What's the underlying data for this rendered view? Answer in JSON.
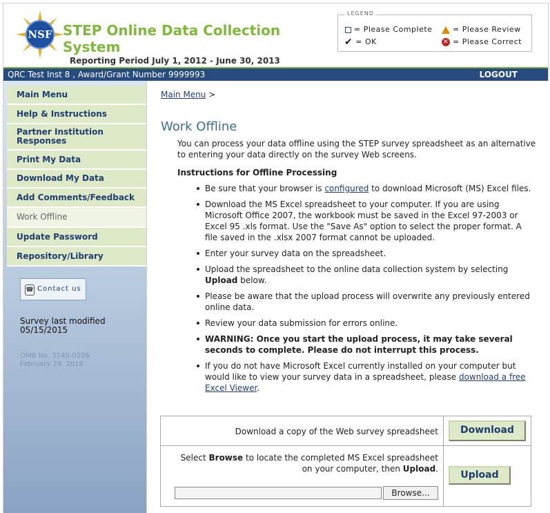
{
  "header": {
    "title_line1": "STEP Online Data Collection",
    "title_line2": "System",
    "reporting_period": "Reporting Period July 1, 2012 - June 30, 2013",
    "logo_text": "NSF"
  },
  "legend": {
    "title": "LEGEND",
    "please_complete": "= Please Complete",
    "please_review": "= Please Review",
    "ok": "= OK",
    "please_correct": "= Please Correct"
  },
  "bar": {
    "info": "QRC Test Inst 8 , Award/Grant Number 9999993",
    "logout": "LOGOUT"
  },
  "sidebar": {
    "items": [
      {
        "label": "Main Menu"
      },
      {
        "label": "Help & Instructions"
      },
      {
        "label": "Partner Institution Responses"
      },
      {
        "label": "Print My Data"
      },
      {
        "label": "Download My Data"
      },
      {
        "label": "Add Comments/Feedback"
      },
      {
        "label": "Work Offline"
      },
      {
        "label": "Update Password"
      },
      {
        "label": "Repository/Library"
      }
    ],
    "contact_us": "Contact us",
    "survey_modified_label": "Survey last modified",
    "survey_modified_date": "05/15/2015",
    "omb_number": "OMB No. 3145-0226",
    "omb_date": "February 29, 2016"
  },
  "main": {
    "breadcrumb_link": "Main Menu",
    "breadcrumb_sep": ">",
    "heading": "Work Offline",
    "intro": "You can process your data offline using the STEP survey spreadsheet as an alternative to entering your data directly on the survey Web screens.",
    "instructions_title": "Instructions for Offline Processing",
    "bullet1_pre": "Be sure that your browser is ",
    "bullet1_link": "configured",
    "bullet1_post": " to download Microsoft (MS) Excel files.",
    "bullet2": "Download the MS Excel spreadsheet to your computer. If you are using Microsoft Office 2007, the workbook must be saved in the Excel 97-2003 or Excel 95 .xls format. Use the \"Save As\" option to select the proper format. A file saved in the .xlsx 2007 format cannot be uploaded.",
    "bullet3": "Enter your survey data on the spreadsheet.",
    "bullet4_pre": "Upload the spreadsheet to the online data collection system by selecting ",
    "bullet4_bold": "Upload",
    "bullet4_post": " below.",
    "bullet5": "Please be aware that the upload process will overwrite any previously entered online data.",
    "bullet6": "Review your data submission for errors online.",
    "bullet7": "WARNING: Once you start the upload process, it may take several seconds to complete. Please do not interrupt this process.",
    "bullet8_pre": "If you do not have Microsoft Excel currently installed on your computer but would like to view your survey data in a spreadsheet, please ",
    "bullet8_link": "download a free Excel Viewer",
    "bullet8_post": "."
  },
  "actions": {
    "download_text": "Download a copy of the Web survey spreadsheet",
    "download_button": "Download",
    "upload_text_pre": "Select ",
    "upload_text_browse": "Browse",
    "upload_text_mid": " to locate the completed MS Excel spreadsheet on your computer, then ",
    "upload_text_upload": "Upload",
    "upload_text_post": ".",
    "upload_button": "Upload",
    "browse_button": "Browse..."
  },
  "colors": {
    "brand_green": "#7fb83a",
    "header_blue": "#274a7f",
    "nav_green": "#dde9c7",
    "heading_teal": "#3d6f8a"
  }
}
